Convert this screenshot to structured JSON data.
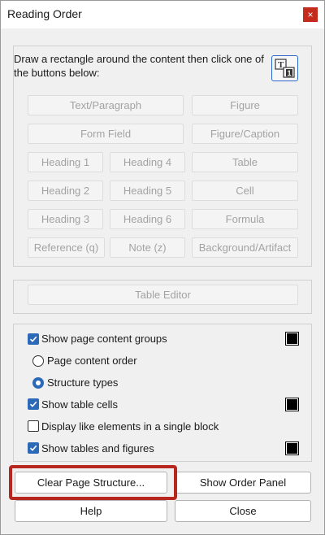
{
  "window": {
    "title": "Reading Order",
    "close_label": "×"
  },
  "instructions": "Draw a rectangle around the content then click one of the buttons below:",
  "tag_buttons": {
    "text_paragraph": "Text/Paragraph",
    "figure": "Figure",
    "form_field": "Form Field",
    "figure_caption": "Figure/Caption",
    "heading_1": "Heading 1",
    "heading_4": "Heading 4",
    "table": "Table",
    "heading_2": "Heading 2",
    "heading_5": "Heading 5",
    "cell": "Cell",
    "heading_3": "Heading 3",
    "heading_6": "Heading 6",
    "formula": "Formula",
    "reference": "Reference (q)",
    "note": "Note (z)",
    "background_artifact": "Background/Artifact"
  },
  "table_editor_label": "Table Editor",
  "options": {
    "show_page_content_groups": {
      "label": "Show page content groups",
      "checked": true
    },
    "page_content_order": {
      "label": "Page content order",
      "selected": false
    },
    "structure_types": {
      "label": "Structure types",
      "selected": true
    },
    "show_table_cells": {
      "label": "Show table cells",
      "checked": true
    },
    "display_like_elements": {
      "label": "Display like elements in a single block",
      "checked": false
    },
    "show_tables_and_figures": {
      "label": "Show tables and figures",
      "checked": true
    }
  },
  "swatch_color": "#000000",
  "buttons": {
    "clear_page_structure": "Clear Page Structure...",
    "show_order_panel": "Show Order Panel",
    "help": "Help",
    "close": "Close"
  },
  "colors": {
    "accent": "#2c6ab8",
    "highlight": "#b8271f",
    "close_button": "#c42b1c"
  }
}
